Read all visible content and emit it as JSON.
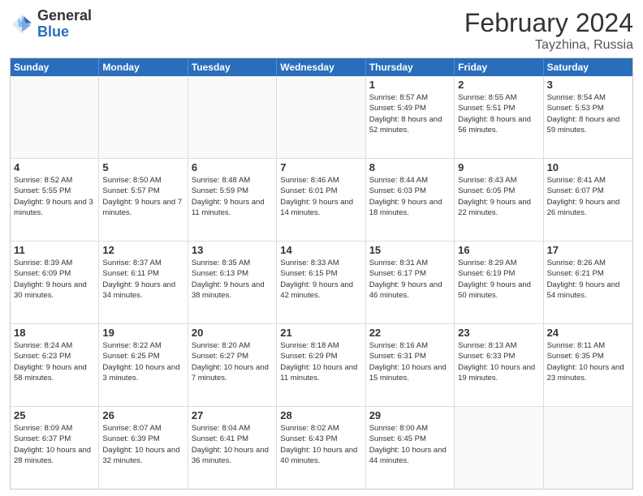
{
  "header": {
    "logo_general": "General",
    "logo_blue": "Blue",
    "month_title": "February 2024",
    "location": "Tayzhina, Russia"
  },
  "weekdays": [
    "Sunday",
    "Monday",
    "Tuesday",
    "Wednesday",
    "Thursday",
    "Friday",
    "Saturday"
  ],
  "weeks": [
    [
      {
        "day": "",
        "info": ""
      },
      {
        "day": "",
        "info": ""
      },
      {
        "day": "",
        "info": ""
      },
      {
        "day": "",
        "info": ""
      },
      {
        "day": "1",
        "info": "Sunrise: 8:57 AM\nSunset: 5:49 PM\nDaylight: 8 hours and 52 minutes."
      },
      {
        "day": "2",
        "info": "Sunrise: 8:55 AM\nSunset: 5:51 PM\nDaylight: 8 hours and 56 minutes."
      },
      {
        "day": "3",
        "info": "Sunrise: 8:54 AM\nSunset: 5:53 PM\nDaylight: 8 hours and 59 minutes."
      }
    ],
    [
      {
        "day": "4",
        "info": "Sunrise: 8:52 AM\nSunset: 5:55 PM\nDaylight: 9 hours and 3 minutes."
      },
      {
        "day": "5",
        "info": "Sunrise: 8:50 AM\nSunset: 5:57 PM\nDaylight: 9 hours and 7 minutes."
      },
      {
        "day": "6",
        "info": "Sunrise: 8:48 AM\nSunset: 5:59 PM\nDaylight: 9 hours and 11 minutes."
      },
      {
        "day": "7",
        "info": "Sunrise: 8:46 AM\nSunset: 6:01 PM\nDaylight: 9 hours and 14 minutes."
      },
      {
        "day": "8",
        "info": "Sunrise: 8:44 AM\nSunset: 6:03 PM\nDaylight: 9 hours and 18 minutes."
      },
      {
        "day": "9",
        "info": "Sunrise: 8:43 AM\nSunset: 6:05 PM\nDaylight: 9 hours and 22 minutes."
      },
      {
        "day": "10",
        "info": "Sunrise: 8:41 AM\nSunset: 6:07 PM\nDaylight: 9 hours and 26 minutes."
      }
    ],
    [
      {
        "day": "11",
        "info": "Sunrise: 8:39 AM\nSunset: 6:09 PM\nDaylight: 9 hours and 30 minutes."
      },
      {
        "day": "12",
        "info": "Sunrise: 8:37 AM\nSunset: 6:11 PM\nDaylight: 9 hours and 34 minutes."
      },
      {
        "day": "13",
        "info": "Sunrise: 8:35 AM\nSunset: 6:13 PM\nDaylight: 9 hours and 38 minutes."
      },
      {
        "day": "14",
        "info": "Sunrise: 8:33 AM\nSunset: 6:15 PM\nDaylight: 9 hours and 42 minutes."
      },
      {
        "day": "15",
        "info": "Sunrise: 8:31 AM\nSunset: 6:17 PM\nDaylight: 9 hours and 46 minutes."
      },
      {
        "day": "16",
        "info": "Sunrise: 8:29 AM\nSunset: 6:19 PM\nDaylight: 9 hours and 50 minutes."
      },
      {
        "day": "17",
        "info": "Sunrise: 8:26 AM\nSunset: 6:21 PM\nDaylight: 9 hours and 54 minutes."
      }
    ],
    [
      {
        "day": "18",
        "info": "Sunrise: 8:24 AM\nSunset: 6:23 PM\nDaylight: 9 hours and 58 minutes."
      },
      {
        "day": "19",
        "info": "Sunrise: 8:22 AM\nSunset: 6:25 PM\nDaylight: 10 hours and 3 minutes."
      },
      {
        "day": "20",
        "info": "Sunrise: 8:20 AM\nSunset: 6:27 PM\nDaylight: 10 hours and 7 minutes."
      },
      {
        "day": "21",
        "info": "Sunrise: 8:18 AM\nSunset: 6:29 PM\nDaylight: 10 hours and 11 minutes."
      },
      {
        "day": "22",
        "info": "Sunrise: 8:16 AM\nSunset: 6:31 PM\nDaylight: 10 hours and 15 minutes."
      },
      {
        "day": "23",
        "info": "Sunrise: 8:13 AM\nSunset: 6:33 PM\nDaylight: 10 hours and 19 minutes."
      },
      {
        "day": "24",
        "info": "Sunrise: 8:11 AM\nSunset: 6:35 PM\nDaylight: 10 hours and 23 minutes."
      }
    ],
    [
      {
        "day": "25",
        "info": "Sunrise: 8:09 AM\nSunset: 6:37 PM\nDaylight: 10 hours and 28 minutes."
      },
      {
        "day": "26",
        "info": "Sunrise: 8:07 AM\nSunset: 6:39 PM\nDaylight: 10 hours and 32 minutes."
      },
      {
        "day": "27",
        "info": "Sunrise: 8:04 AM\nSunset: 6:41 PM\nDaylight: 10 hours and 36 minutes."
      },
      {
        "day": "28",
        "info": "Sunrise: 8:02 AM\nSunset: 6:43 PM\nDaylight: 10 hours and 40 minutes."
      },
      {
        "day": "29",
        "info": "Sunrise: 8:00 AM\nSunset: 6:45 PM\nDaylight: 10 hours and 44 minutes."
      },
      {
        "day": "",
        "info": ""
      },
      {
        "day": "",
        "info": ""
      }
    ]
  ]
}
